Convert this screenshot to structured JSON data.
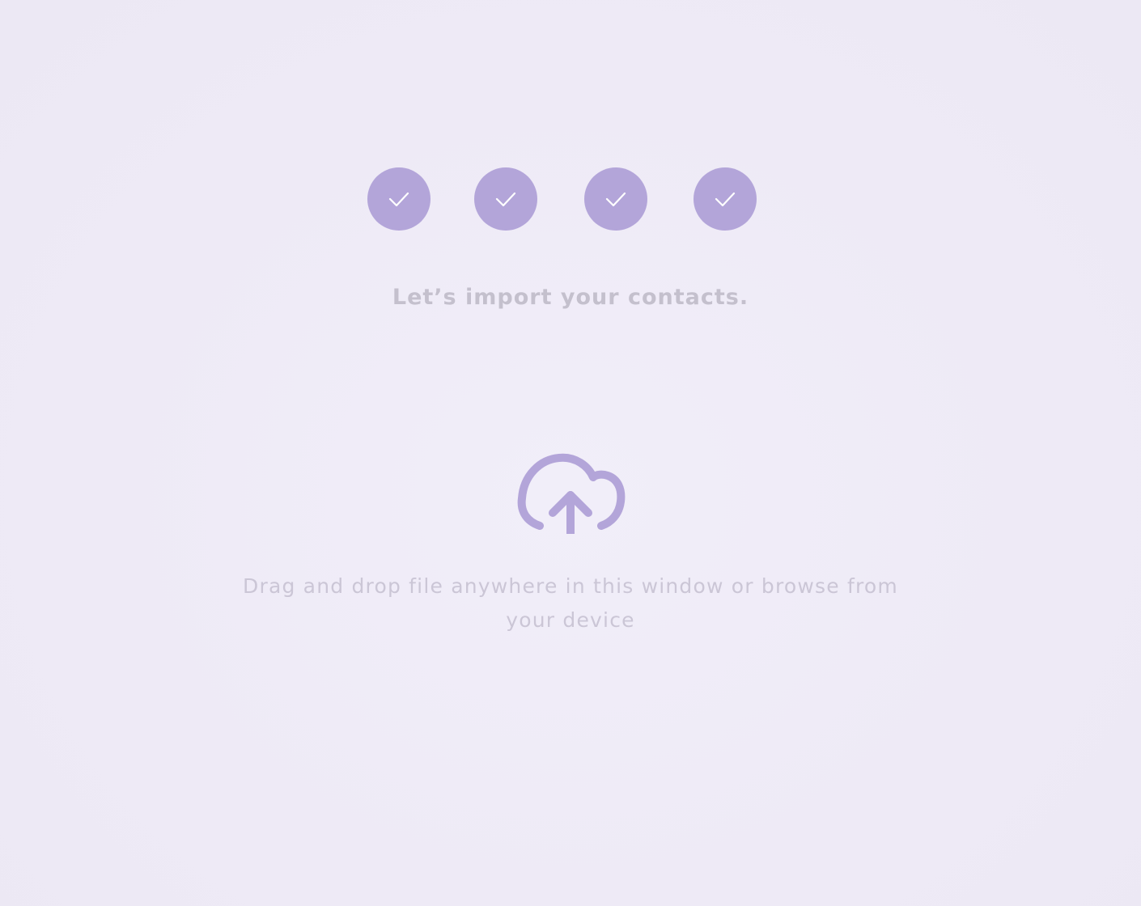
{
  "progress": {
    "steps": [
      {
        "name": "step-1",
        "status": "complete",
        "icon": "check-icon"
      },
      {
        "name": "step-2",
        "status": "complete",
        "icon": "check-icon"
      },
      {
        "name": "step-3",
        "status": "complete",
        "icon": "check-icon"
      },
      {
        "name": "step-4",
        "status": "complete",
        "icon": "check-icon"
      }
    ],
    "completed_count": 4,
    "total_count": 4
  },
  "headline": "Let’s import your contacts.",
  "upload": {
    "icon": "cloud-upload-icon",
    "instructions": "Drag and drop file anywhere in this window or browse from your device"
  },
  "colors": {
    "background": "#EFEBF7",
    "accent": "#B3A5D9",
    "headline_text": "#C4C0CD",
    "body_text": "#CBC6D6"
  }
}
